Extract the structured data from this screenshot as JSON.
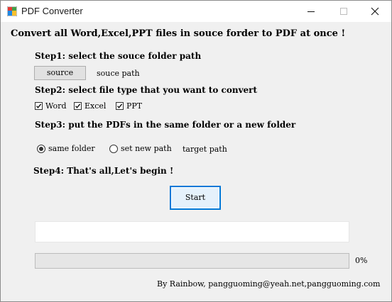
{
  "window": {
    "title": "PDF Converter",
    "icon": "pdf-app-icon"
  },
  "heading": "Convert all Word,Excel,PPT files in souce forder to PDF at once !",
  "step1": {
    "label": "Step1: select the souce folder path",
    "source_button": "source",
    "source_path": "souce path"
  },
  "step2": {
    "label": "Step2: select file type that you want to convert",
    "options": [
      {
        "label": "Word",
        "checked": true
      },
      {
        "label": "Excel",
        "checked": true
      },
      {
        "label": "PPT",
        "checked": true
      }
    ]
  },
  "step3": {
    "label": "Step3: put the PDFs in the same folder or a new folder",
    "same_folder": "same folder",
    "new_path": "set new path",
    "selected": "same folder",
    "target_path": "target path"
  },
  "step4": {
    "label": "Step4: That's all,Let's begin !",
    "start_button": "Start"
  },
  "log_text": "",
  "progress": {
    "value": 0,
    "label": "0%"
  },
  "footer": "By Rainbow, pangguoming@yeah.net,pangguoming.com",
  "colors": {
    "accent": "#0078d7",
    "window_bg": "#f0f0f0"
  }
}
